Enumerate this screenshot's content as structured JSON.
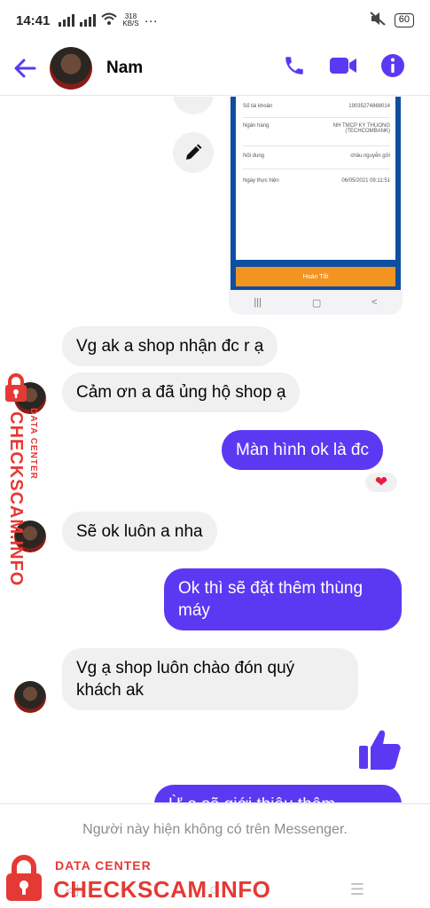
{
  "status_bar": {
    "time": "14:41",
    "speed_value": "318",
    "speed_unit": "KB/S",
    "more": "···",
    "battery": "60"
  },
  "header": {
    "contact_name": "Nam",
    "back_icon": "arrow-left-icon",
    "call_icon": "phone-icon",
    "video_icon": "video-camera-icon",
    "info_icon": "info-icon",
    "accent": "#5b39f3"
  },
  "shared_screenshot": {
    "rows": [
      {
        "label": "Số tài khoản",
        "value": "19035274868014"
      },
      {
        "label": "Ngân hàng",
        "value": "NH TMCP KY THUONG (TECHCOMBANK)"
      },
      {
        "label": "Nội dung",
        "value": "châu nguyễn gửi"
      },
      {
        "label": "Ngày thực hiện",
        "value": "06/05/2021 09:11:51"
      }
    ],
    "button_label": "Hoàn Tất",
    "nav": [
      "|||",
      "▢",
      "<"
    ]
  },
  "messages": [
    {
      "side": "in",
      "text": "Vg ak a shop nhận đc r ạ"
    },
    {
      "side": "in",
      "text": "Cảm ơn a đã ủng hộ shop ạ"
    },
    {
      "side": "out",
      "text": "Màn hình ok là đc",
      "reaction": "❤"
    },
    {
      "side": "in",
      "text": "Sẽ ok luôn a nha"
    },
    {
      "side": "out",
      "text": "Ok thì sẽ đặt thêm thùng máy"
    },
    {
      "side": "in",
      "text": "Vg ạ shop luôn chào đón quý khách ak"
    },
    {
      "side": "out",
      "text": "Ừ a sẽ giới thiệu thêm"
    }
  ],
  "footer": {
    "notice": "Người này hiện không có trên Messenger.",
    "nav": [
      "◁",
      "○",
      "☰"
    ]
  },
  "watermark": {
    "line1": "DATA CENTER",
    "line2": "CHECKSCAM.INFO",
    "color": "#e53935"
  }
}
